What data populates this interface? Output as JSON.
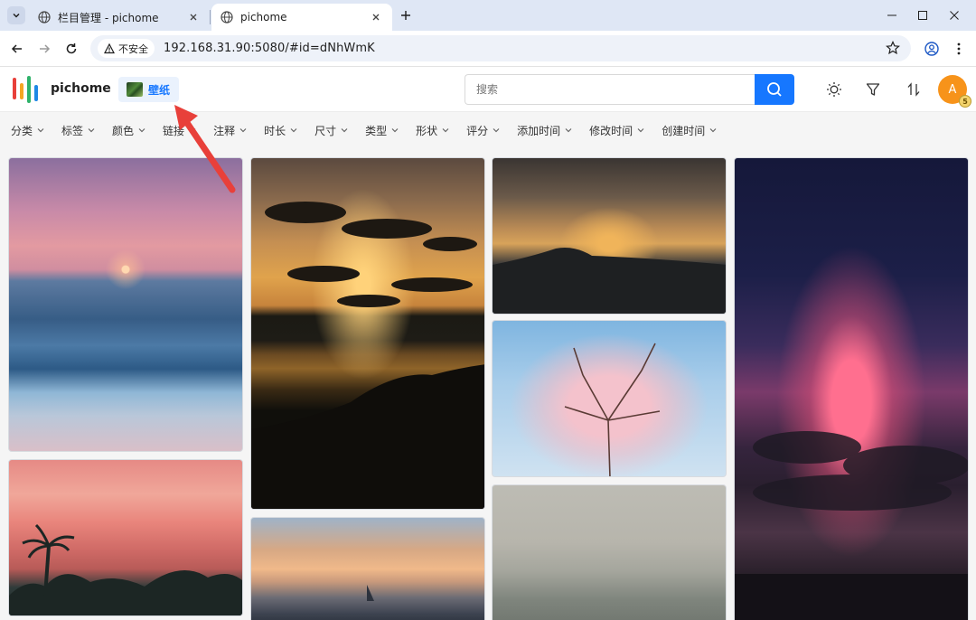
{
  "browser": {
    "tabs": [
      {
        "title": "栏目管理 - pichome",
        "active": false
      },
      {
        "title": "pichome",
        "active": true
      }
    ],
    "security_label": "不安全",
    "url": "192.168.31.90:5080/#id=dNhWmK"
  },
  "app": {
    "name": "pichome",
    "library_name": "壁纸",
    "search_placeholder": "搜索",
    "avatar_letter": "A",
    "avatar_badge": "5"
  },
  "filters": [
    "分类",
    "标签",
    "颜色",
    "链接",
    "注释",
    "时长",
    "尺寸",
    "类型",
    "形状",
    "评分",
    "添加时间",
    "修改时间",
    "创建时间"
  ],
  "gallery": {
    "images": [
      "beach-sunset",
      "dark-sunset-clouds",
      "mountain-sunset",
      "cherry-blossom",
      "foggy-forest",
      "purple-pink-sky",
      "palm-pink-sky",
      "sailboat-sunset"
    ]
  },
  "colors": {
    "accent": "#1677ff",
    "avatar": "#f7931a",
    "annotation_arrow": "#e8403a"
  }
}
